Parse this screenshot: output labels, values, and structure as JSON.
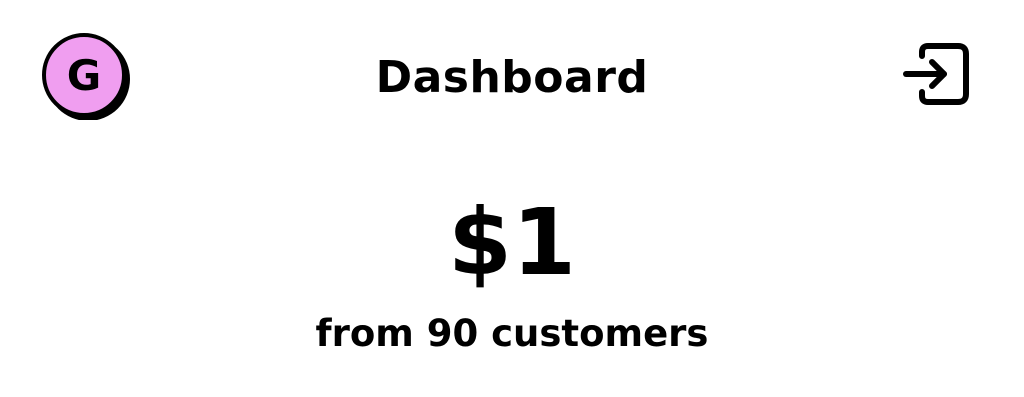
{
  "header": {
    "title": "Dashboard",
    "logo_icon": "g-logo-icon",
    "logo_letter": "G",
    "logo_color": "#F09EF0",
    "logout_icon": "logout-icon"
  },
  "summary": {
    "amount": "$1",
    "subtitle": "from 90 customers"
  }
}
